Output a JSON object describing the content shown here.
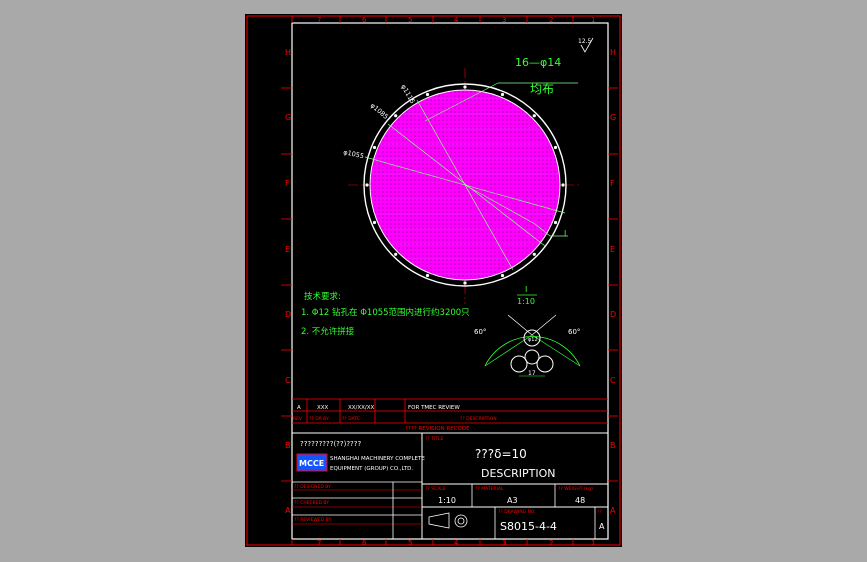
{
  "border_columns": [
    "7",
    "6",
    "5",
    "4",
    "3",
    "2",
    "1"
  ],
  "border_rows_left": [
    "H",
    "G",
    "F",
    "E",
    "D",
    "C",
    "B",
    "A"
  ],
  "border_rows_right": [
    "H",
    "G",
    "F",
    "E",
    "D",
    "C",
    "B",
    "A"
  ],
  "roughness": "12.5",
  "hole_callout": {
    "count_dia": "16—φ14",
    "note": "均布"
  },
  "dims": {
    "d1115": "φ1115",
    "d1085": "φ1085",
    "d1055": "φ1055"
  },
  "detail_marker": "I",
  "detail": {
    "label": "I",
    "scale": "1:10",
    "angle_left": "60°",
    "angle_right": "60°",
    "dia": "φ12",
    "pitch": "17"
  },
  "notes": {
    "title": "技术要求:",
    "line1": "1. Φ12 钻孔在 Φ1055范围内进行约3200只",
    "line2": "2. 不允许拼接"
  },
  "revision": {
    "row": [
      "A",
      "XXX",
      "XX/XX/XX",
      "FOR TMEC REVIEW"
    ],
    "header": [
      "REV",
      "?? DR BY",
      "?? DATE",
      "?? DESCRIPTION"
    ],
    "footer": "???? REVISION RECODE"
  },
  "company": {
    "line1": "?????????(??)????",
    "logo": "MCCE",
    "name1": "SHANGHAI MACHINERY COMPLETE",
    "name2": "EQUIPMENT (GROUP) CO.,LTD."
  },
  "title_block": {
    "title_label": "?? TITLE",
    "title": "???δ=10",
    "description": "DESCRIPTION",
    "designed_by": "?? DESIGNED BY",
    "checked_by": "?? CHECKED BY",
    "reviewed_by": "?? REVIEWED BY",
    "scale_label": "?? SCALE",
    "scale": "1:10",
    "material_label": "?? MATERIAL",
    "material": "A3",
    "weight_label": "?? WEIGHT (kg)",
    "weight": "48",
    "drawing_no_label": "?? DRAWING NO.",
    "drawing_no": "S8015-4-4",
    "rev_label": "??",
    "rev": "A"
  }
}
